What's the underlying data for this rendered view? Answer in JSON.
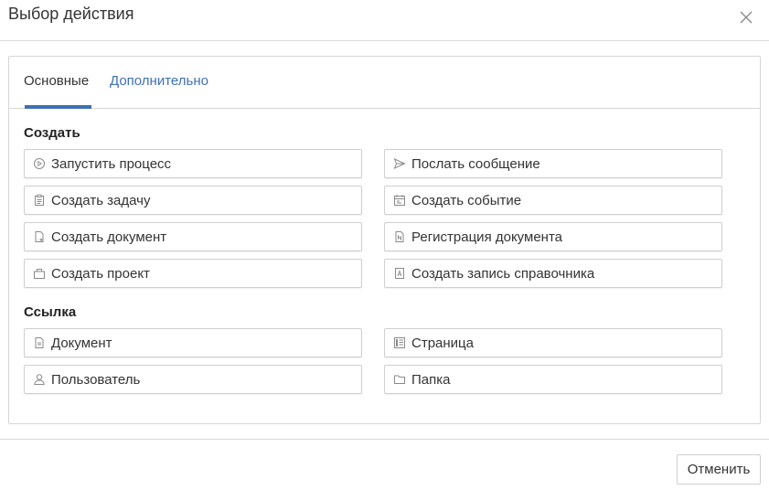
{
  "dialog": {
    "title": "Выбор действия",
    "close_icon": "close-icon"
  },
  "tabs": [
    {
      "label": "Основные",
      "active": true
    },
    {
      "label": "Дополнительно",
      "active": false
    }
  ],
  "sections": {
    "create": {
      "title": "Создать",
      "items": [
        {
          "label": "Запустить процесс",
          "icon": "play-circle-icon"
        },
        {
          "label": "Послать сообщение",
          "icon": "send-icon"
        },
        {
          "label": "Создать задачу",
          "icon": "task-clipboard-icon"
        },
        {
          "label": "Создать событие",
          "icon": "calendar-event-icon"
        },
        {
          "label": "Создать документ",
          "icon": "document-add-icon"
        },
        {
          "label": "Регистрация документа",
          "icon": "document-register-icon"
        },
        {
          "label": "Создать проект",
          "icon": "briefcase-icon"
        },
        {
          "label": "Создать запись справочника",
          "icon": "directory-entry-icon"
        }
      ]
    },
    "link": {
      "title": "Ссылка",
      "items": [
        {
          "label": "Документ",
          "icon": "document-icon"
        },
        {
          "label": "Страница",
          "icon": "page-icon"
        },
        {
          "label": "Пользователь",
          "icon": "user-icon"
        },
        {
          "label": "Папка",
          "icon": "folder-icon"
        }
      ]
    }
  },
  "footer": {
    "cancel_label": "Отменить"
  },
  "colors": {
    "accent": "#3f6fb5",
    "border": "#cfcfcf",
    "text": "#333333",
    "icon": "#8a8a8a"
  }
}
